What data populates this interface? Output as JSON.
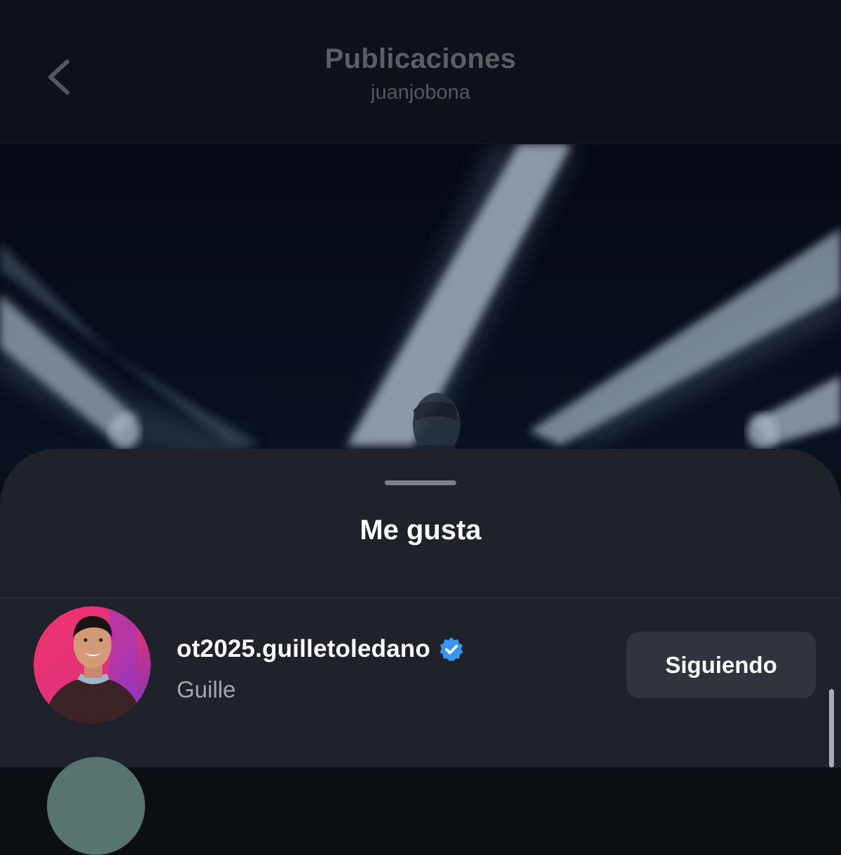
{
  "header": {
    "title": "Publicaciones",
    "subtitle": "juanjobona",
    "back_icon": "chevron-left-icon"
  },
  "sheet": {
    "title": "Me gusta"
  },
  "likes": [
    {
      "username": "ot2025.guilletoledano",
      "full_name": "Guille",
      "verified": true,
      "button_label": "Siguiendo"
    }
  ],
  "colors": {
    "background": "#0b0e13",
    "sheet": "#1f2229",
    "button": "#30343c",
    "verified": "#3897f0"
  }
}
